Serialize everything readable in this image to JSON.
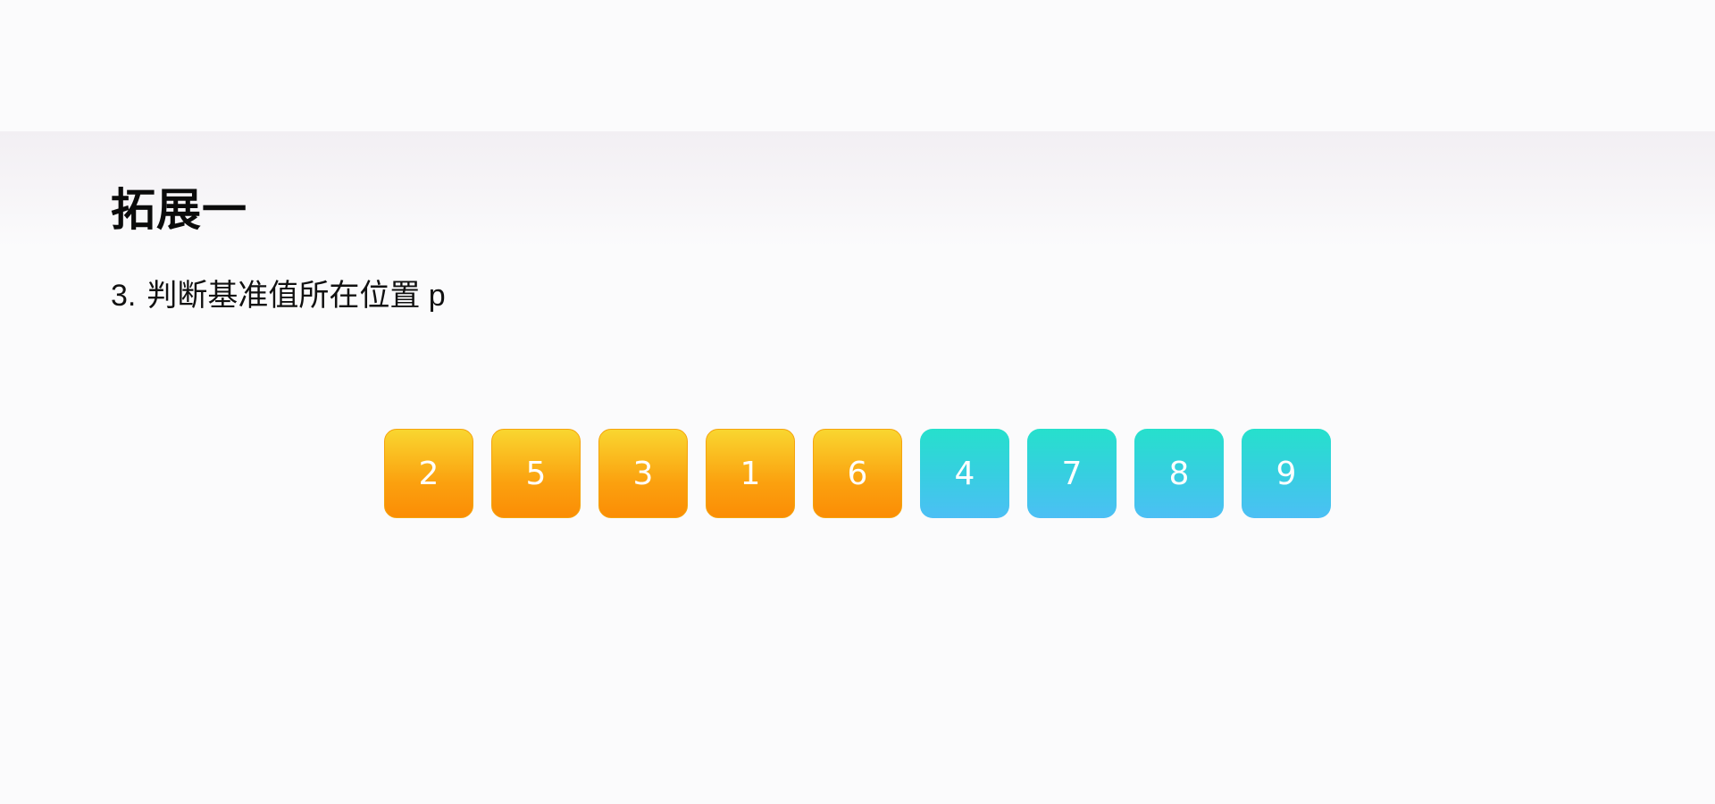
{
  "slide": {
    "title": "拓展一",
    "step": {
      "number": "3.",
      "text": "判断基准值所在位置 p"
    }
  },
  "array": {
    "cells": [
      {
        "value": "2",
        "group": "left"
      },
      {
        "value": "5",
        "group": "left"
      },
      {
        "value": "3",
        "group": "left"
      },
      {
        "value": "1",
        "group": "left"
      },
      {
        "value": "6",
        "group": "left"
      },
      {
        "value": "4",
        "group": "right"
      },
      {
        "value": "7",
        "group": "right"
      },
      {
        "value": "8",
        "group": "right"
      },
      {
        "value": "9",
        "group": "right"
      }
    ],
    "colors": {
      "left_top": "#f9d630",
      "left_bottom": "#fb8d05",
      "right_top": "#26e0cc",
      "right_bottom": "#4cbff5"
    }
  }
}
